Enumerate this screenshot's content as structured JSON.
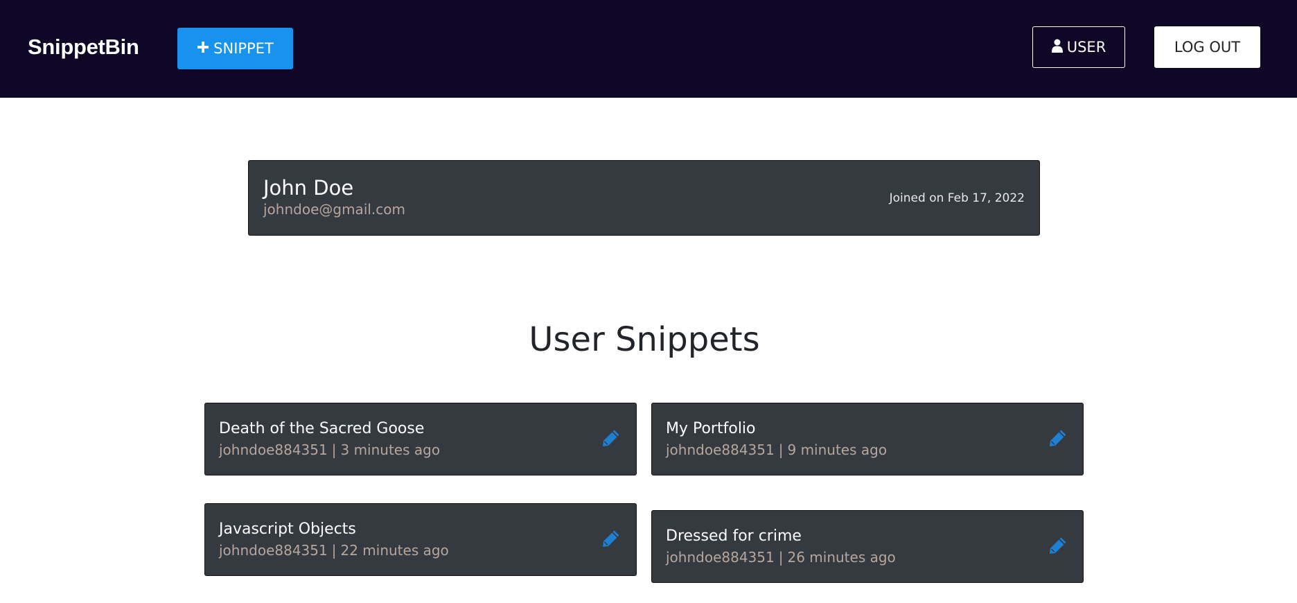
{
  "header": {
    "brand": "SnippetBin",
    "new_snippet_label": "SNIPPET",
    "new_snippet_icon": "plus-icon",
    "user_label": "USER",
    "user_icon": "user-icon",
    "logout_label": "LOG OUT"
  },
  "profile": {
    "name": "John Doe",
    "email": "johndoe@gmail.com",
    "joined": "Joined on Feb 17, 2022"
  },
  "section_title": "User Snippets",
  "snippets": [
    {
      "title": "Death of the Sacred Goose",
      "author": "johndoe884351",
      "time": "3 minutes ago"
    },
    {
      "title": "My Portfolio",
      "author": "johndoe884351",
      "time": "9 minutes ago"
    },
    {
      "title": "Javascript Objects",
      "author": "johndoe884351",
      "time": "22 minutes ago"
    },
    {
      "title": "Dressed for crime",
      "author": "johndoe884351",
      "time": "26 minutes ago"
    }
  ],
  "colors": {
    "nav_bg": "#0e0725",
    "primary": "#1793ed",
    "card_bg": "#343a40",
    "meta_text": "#b7a69c",
    "edit_icon": "#1f7fd1"
  }
}
